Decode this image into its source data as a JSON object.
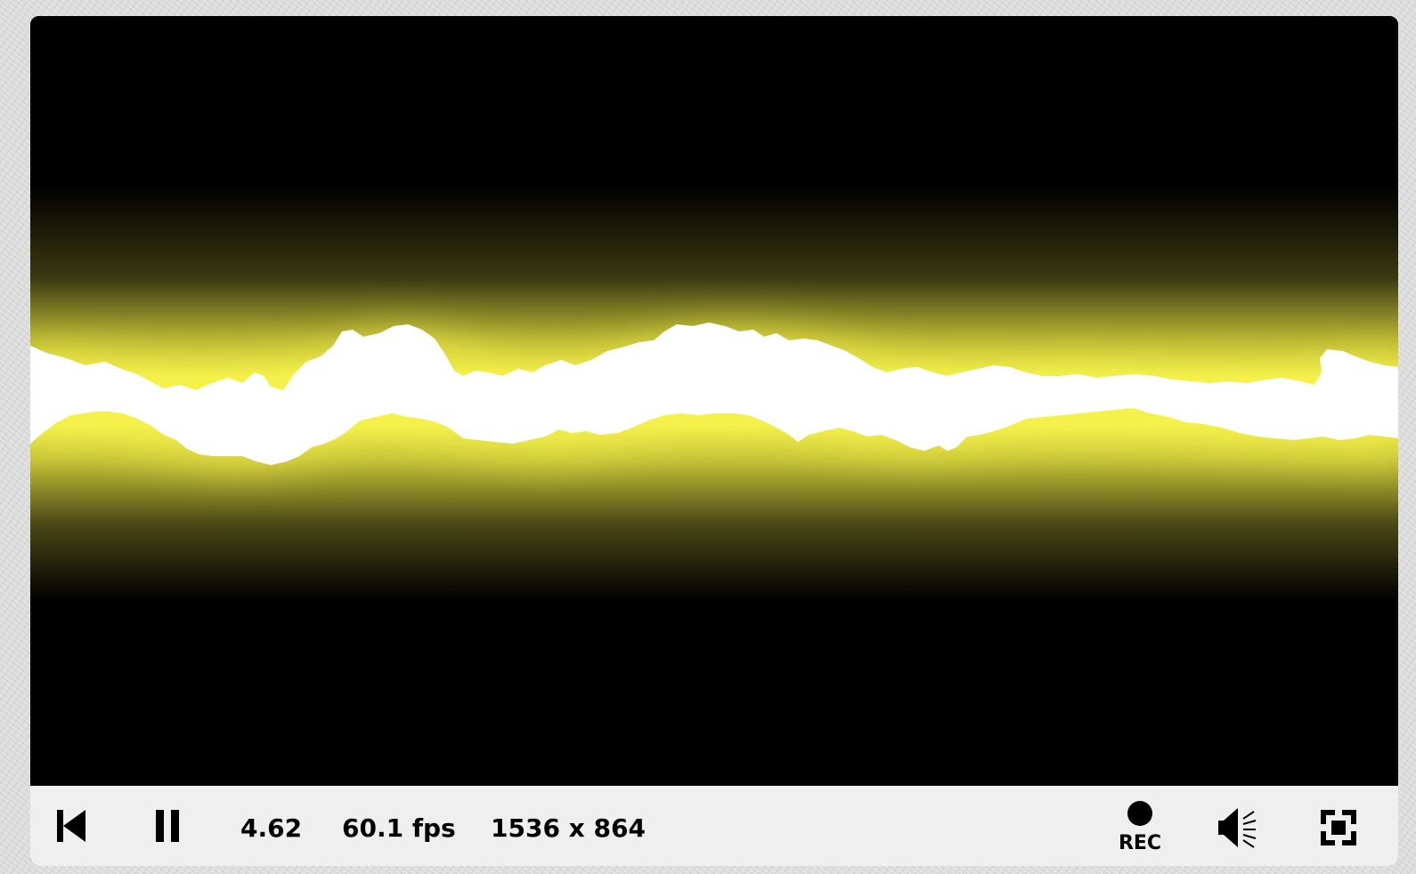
{
  "viewer": {
    "time": "4.62",
    "fps": "60.1 fps",
    "resolution": "1536 x 864"
  },
  "controls": {
    "rewind_icon": "skip-to-start-icon",
    "pause_icon": "pause-icon",
    "record_label": "REC",
    "record_icon": "record-dot-icon",
    "volume_icon": "speaker-icon",
    "fullscreen_icon": "fullscreen-icon"
  },
  "colors": {
    "glow": "#f6f24a",
    "core": "#ffffff",
    "background": "#000000",
    "toolbar": "#efefef"
  }
}
